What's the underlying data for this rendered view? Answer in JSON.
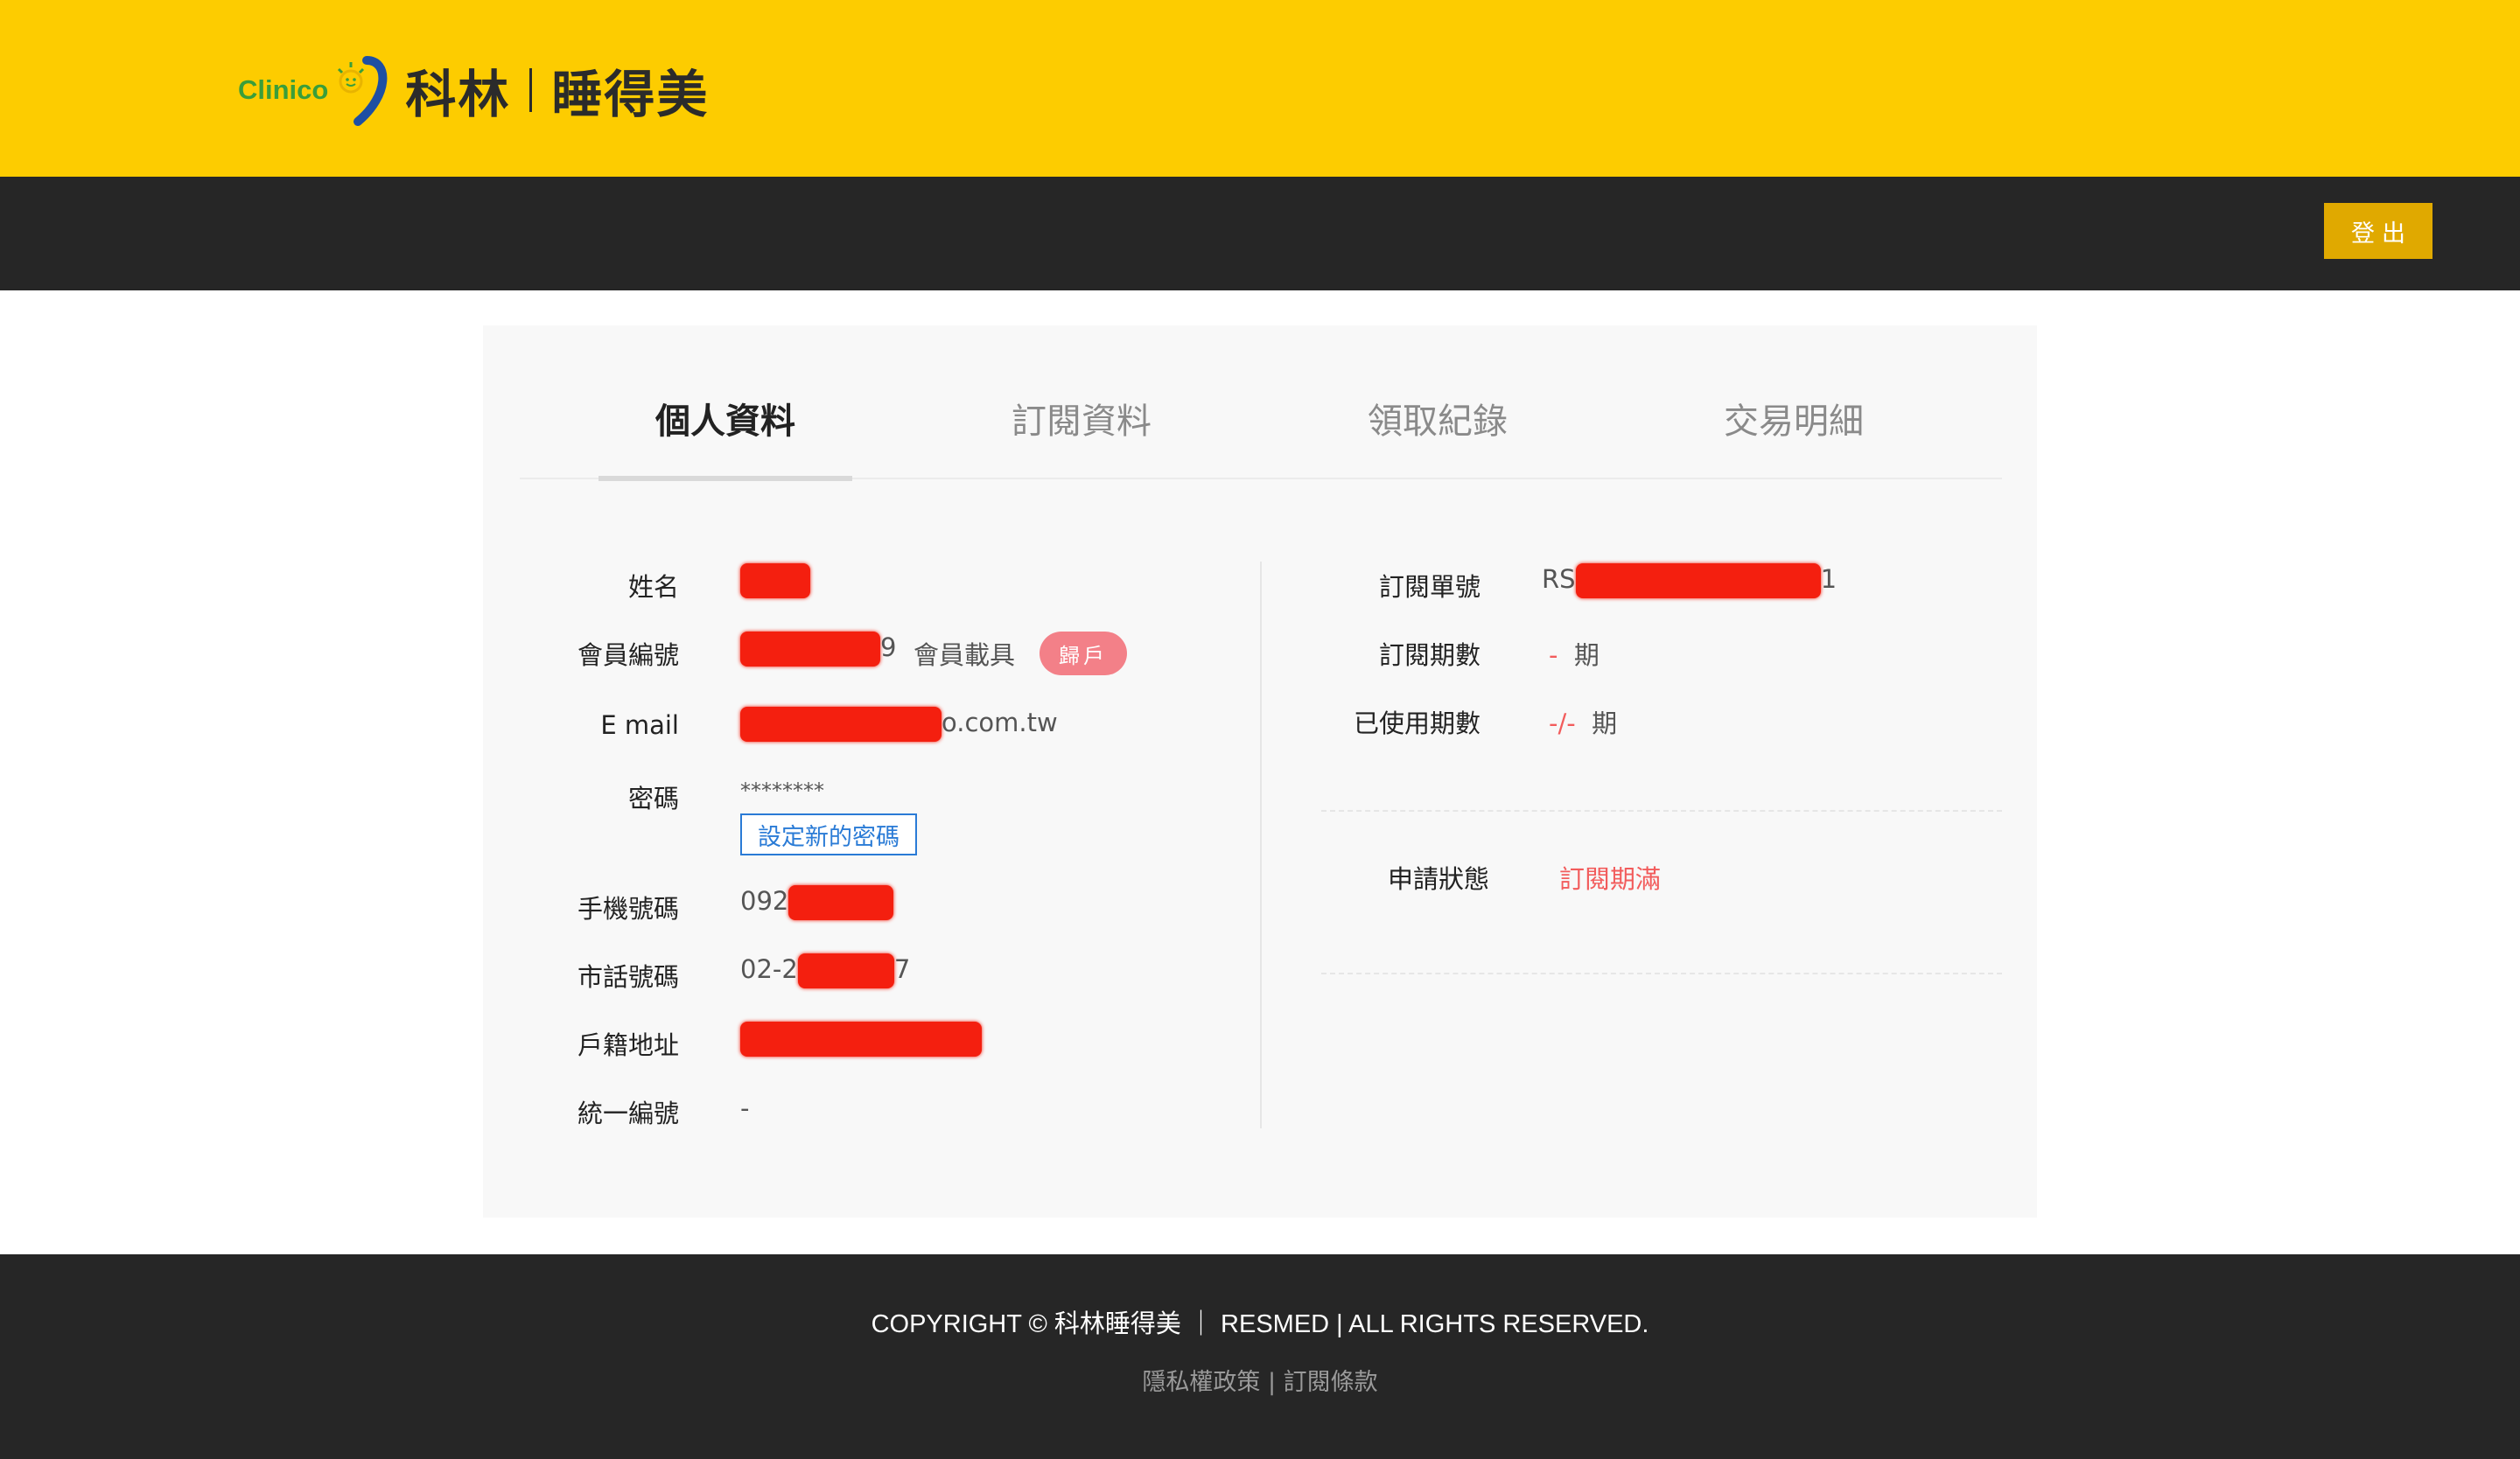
{
  "brand": {
    "logo_latin": "Clinico",
    "logo_cn_left": "科林",
    "logo_cn_right": "睡得美",
    "accent_color": "#FDCC00"
  },
  "nav": {
    "logout_label": "登出"
  },
  "tabs": [
    {
      "label": "個人資料",
      "active": true
    },
    {
      "label": "訂閱資料",
      "active": false
    },
    {
      "label": "領取紀錄",
      "active": false
    },
    {
      "label": "交易明細",
      "active": false
    }
  ],
  "profile": {
    "name": {
      "label": "姓名",
      "value": ""
    },
    "member_id": {
      "label": "會員編號",
      "value_prefix": "",
      "value_suffix": "9",
      "carrier_label": "會員載具",
      "carrier_badge": "歸戶"
    },
    "email": {
      "label": "E mail",
      "value_suffix": "o.com.tw"
    },
    "password": {
      "label": "密碼",
      "value": "********",
      "set_button": "設定新的密碼"
    },
    "mobile": {
      "label": "手機號碼",
      "value_prefix": "092"
    },
    "phone": {
      "label": "市話號碼",
      "value_prefix": "02-2",
      "value_suffix": "7"
    },
    "address": {
      "label": "戶籍地址"
    },
    "tax_id": {
      "label": "統一編號",
      "value": "-"
    }
  },
  "subscription": {
    "order_no": {
      "label": "訂閱單號",
      "value_prefix": "RS",
      "value_suffix": "1"
    },
    "periods": {
      "label": "訂閱期數",
      "value": "-",
      "unit": "期"
    },
    "used_periods": {
      "label": "已使用期數",
      "value": "-/-",
      "unit": "期"
    },
    "status": {
      "label": "申請狀態",
      "value": "訂閱期滿"
    }
  },
  "footer": {
    "copyright": "COPYRIGHT © 科林睡得美 ｜ RESMED | ALL RIGHTS RESERVED.",
    "privacy": "隱私權政策",
    "separator": " | ",
    "terms": "訂閱條款"
  }
}
